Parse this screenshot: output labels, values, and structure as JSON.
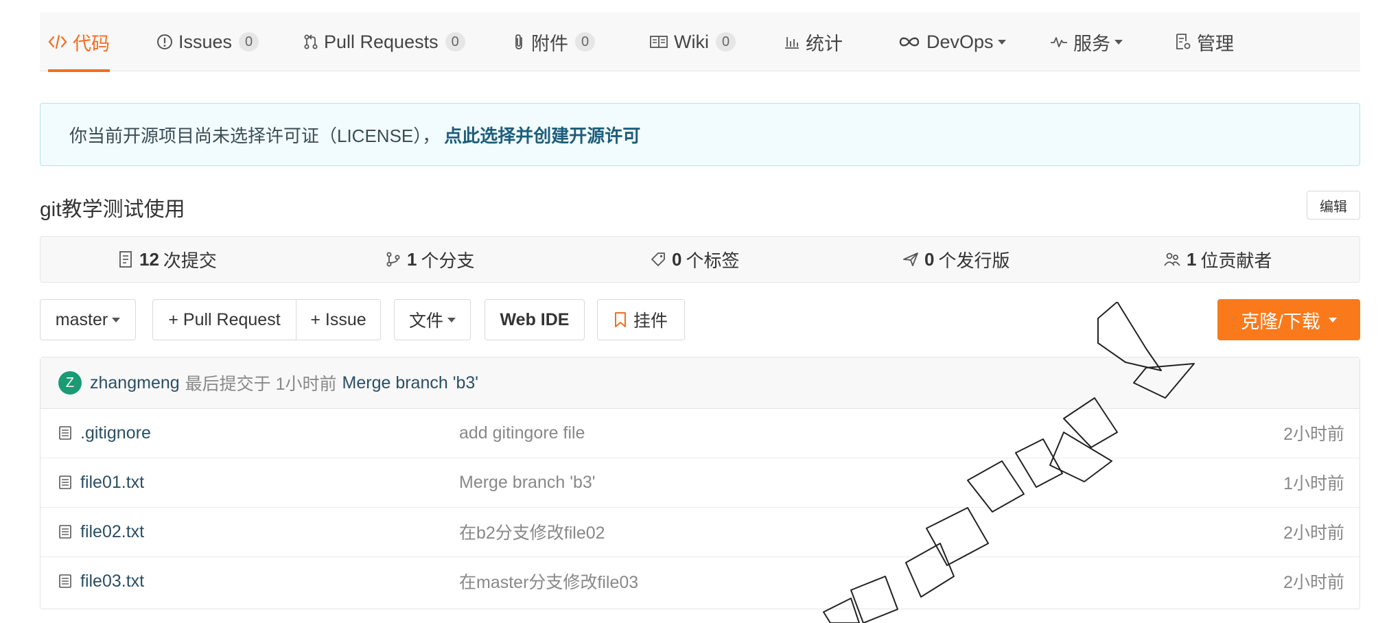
{
  "tabs": [
    {
      "label": "代码",
      "icon": "code-icon",
      "active": true
    },
    {
      "label": "Issues",
      "icon": "info-circle-icon",
      "badge": "0"
    },
    {
      "label": "Pull Requests",
      "icon": "pull-request-icon",
      "badge": "0"
    },
    {
      "label": "附件",
      "icon": "paperclip-icon",
      "badge": "0"
    },
    {
      "label": "Wiki",
      "icon": "book-icon",
      "badge": "0"
    },
    {
      "label": "统计",
      "icon": "bar-chart-icon"
    },
    {
      "label": "DevOps",
      "icon": "infinity-icon",
      "dropdown": true
    },
    {
      "label": "服务",
      "icon": "pulse-icon",
      "dropdown": true
    },
    {
      "label": "管理",
      "icon": "settings-doc-icon"
    }
  ],
  "alert": {
    "text": "你当前开源项目尚未选择许可证（LICENSE），",
    "link": "点此选择并创建开源许可"
  },
  "repo": {
    "description": "git教学测试使用",
    "edit_label": "编辑"
  },
  "stats": [
    {
      "icon": "commit-log-icon",
      "count": "12",
      "label": "次提交"
    },
    {
      "icon": "branch-icon",
      "count": "1",
      "label": "个分支"
    },
    {
      "icon": "tag-icon",
      "count": "0",
      "label": "个标签"
    },
    {
      "icon": "release-icon",
      "count": "0",
      "label": "个发行版"
    },
    {
      "icon": "contributors-icon",
      "count": "1",
      "label": "位贡献者"
    }
  ],
  "toolbar": {
    "branch": "master",
    "pull_request": "+ Pull Request",
    "issue": "+ Issue",
    "files": "文件",
    "web_ide": "Web IDE",
    "widget": "挂件",
    "clone": "克隆/下载"
  },
  "last_commit": {
    "avatar_letter": "Z",
    "author": "zhangmeng",
    "meta": "最后提交于 1小时前",
    "message": "Merge branch 'b3'"
  },
  "files": [
    {
      "name": ".gitignore",
      "message": "add gitingore file",
      "time": "2小时前"
    },
    {
      "name": "file01.txt",
      "message": "Merge branch 'b3'",
      "time": "1小时前"
    },
    {
      "name": "file02.txt",
      "message": "在b2分支修改file02",
      "time": "2小时前"
    },
    {
      "name": "file03.txt",
      "message": "在master分支修改file03",
      "time": "2小时前"
    }
  ],
  "colors": {
    "accent": "#f46d22",
    "clone_button": "#fa7a1b",
    "link": "#2b4f63",
    "avatar": "#1a9b73"
  }
}
